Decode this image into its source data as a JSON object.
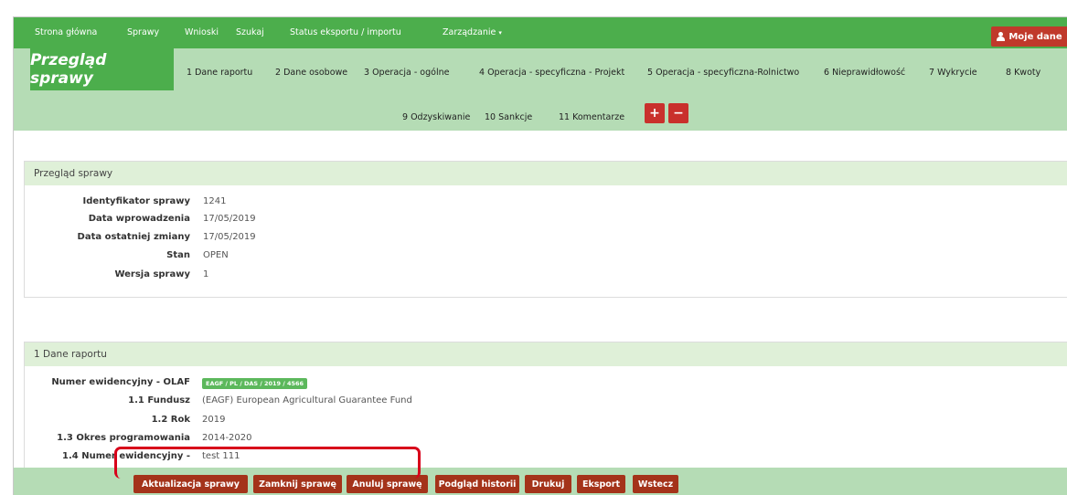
{
  "topnav": {
    "items": [
      "Strona główna",
      "Sprawy",
      "Wnioski",
      "Szukaj",
      "Status eksportu / importu",
      "Zarządzanie"
    ],
    "dropdown_caret": "▾",
    "user_button": "Moje dane",
    "user_icon": "user-icon"
  },
  "tabs": {
    "active_title": "Przegląd sprawy",
    "row1": [
      "1 Dane raportu",
      "2 Dane osobowe",
      "3 Operacja - ogólne",
      "4 Operacja - specyficzna - Projekt",
      "5 Operacja - specyficzna-Rolnictwo",
      "6 Nieprawidłowość",
      "7 Wykrycie",
      "8 Kwoty"
    ],
    "row2": [
      "9 Odzyskiwanie",
      "10 Sankcje",
      "11 Komentarze"
    ],
    "add_label": "+",
    "remove_label": "−"
  },
  "overview": {
    "header": "Przegląd sprawy",
    "fields": [
      {
        "label": "Identyfikator sprawy",
        "value": "1241"
      },
      {
        "label": "Data wprowadzenia",
        "value": "17/05/2019"
      },
      {
        "label": "Data ostatniej zmiany",
        "value": "17/05/2019"
      },
      {
        "label": "Stan",
        "value": "OPEN"
      },
      {
        "label": "Wersja sprawy",
        "value": "1"
      }
    ]
  },
  "report": {
    "header": "1 Dane raportu",
    "olaf_label": "Numer ewidencyjny - OLAF",
    "olaf_badge": "EAGF / PL / DAS / 2019 / 4566",
    "fields": [
      {
        "label": "1.1 Fundusz",
        "value": "(EAGF) European Agricultural Guarantee Fund"
      },
      {
        "label": "1.2 Rok",
        "value": "2019"
      },
      {
        "label": "1.3 Okres programowania",
        "value": "2014-2020"
      },
      {
        "label": "1.4 Numer ewidencyjny -",
        "value": "test 111"
      }
    ]
  },
  "actions": [
    "Aktualizacja sprawy",
    "Zamknij sprawę",
    "Anuluj sprawę",
    "Podgląd historii",
    "Drukuj",
    "Eksport",
    "Wstecz"
  ],
  "colors": {
    "nav_green": "#4cae4c",
    "band_green": "#b5dcb5",
    "panel_head": "#dff0d8",
    "action_red": "#a4331a",
    "highlight_red": "#d8001a"
  }
}
